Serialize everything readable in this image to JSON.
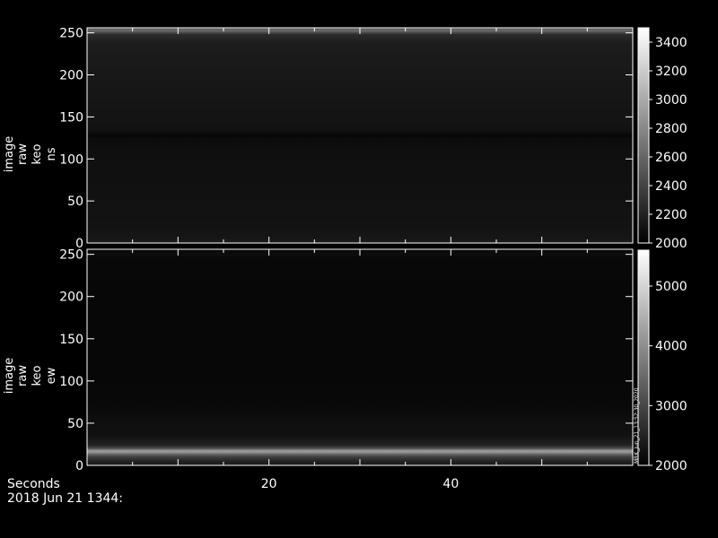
{
  "chart_data": [
    {
      "type": "heatmap",
      "ylabel": [
        "image",
        "raw",
        "keo",
        "ns"
      ],
      "xlim": [
        0,
        60
      ],
      "ylim": [
        0,
        256
      ],
      "x_ticks": [
        20,
        40
      ],
      "y_ticks": [
        0,
        50,
        100,
        150,
        200,
        250
      ],
      "colorbar": {
        "range": [
          2000,
          3500
        ],
        "ticks": [
          2000,
          2200,
          2400,
          2600,
          2800,
          3000,
          3200,
          3400
        ]
      },
      "profile": [
        {
          "y": 0,
          "value": 2160
        },
        {
          "y": 6,
          "value": 2130
        },
        {
          "y": 20,
          "value": 2110
        },
        {
          "y": 60,
          "value": 2100
        },
        {
          "y": 110,
          "value": 2090
        },
        {
          "y": 124,
          "value": 2070
        },
        {
          "y": 128,
          "value": 2030
        },
        {
          "y": 132,
          "value": 2090
        },
        {
          "y": 140,
          "value": 2110
        },
        {
          "y": 200,
          "value": 2140
        },
        {
          "y": 238,
          "value": 2170
        },
        {
          "y": 248,
          "value": 2260
        },
        {
          "y": 253,
          "value": 2650
        },
        {
          "y": 256,
          "value": 2400
        }
      ]
    },
    {
      "type": "heatmap",
      "ylabel": [
        "image",
        "raw",
        "keo",
        "ew"
      ],
      "xlim": [
        0,
        60
      ],
      "ylim": [
        0,
        256
      ],
      "x_ticks": [
        20,
        40
      ],
      "y_ticks": [
        0,
        50,
        100,
        150,
        200,
        250
      ],
      "colorbar": {
        "range": [
          2000,
          5600
        ],
        "ticks": [
          2000,
          3000,
          4000,
          5000
        ]
      },
      "stamp": "MRK_Jun_21_13:52:30_2020",
      "profile": [
        {
          "y": 0,
          "value": 2350
        },
        {
          "y": 5,
          "value": 2500
        },
        {
          "y": 10,
          "value": 2900
        },
        {
          "y": 13,
          "value": 3400
        },
        {
          "y": 16,
          "value": 4200
        },
        {
          "y": 18,
          "value": 4000
        },
        {
          "y": 20,
          "value": 3100
        },
        {
          "y": 24,
          "value": 2500
        },
        {
          "y": 35,
          "value": 2240
        },
        {
          "y": 55,
          "value": 2200
        },
        {
          "y": 63,
          "value": 2140
        },
        {
          "y": 100,
          "value": 2100
        },
        {
          "y": 200,
          "value": 2100
        },
        {
          "y": 245,
          "value": 2110
        },
        {
          "y": 250,
          "value": 2180
        },
        {
          "y": 256,
          "value": 2120
        }
      ]
    }
  ],
  "footer": {
    "xlabel": "Seconds",
    "date": "2018 Jun 21 1344:"
  }
}
